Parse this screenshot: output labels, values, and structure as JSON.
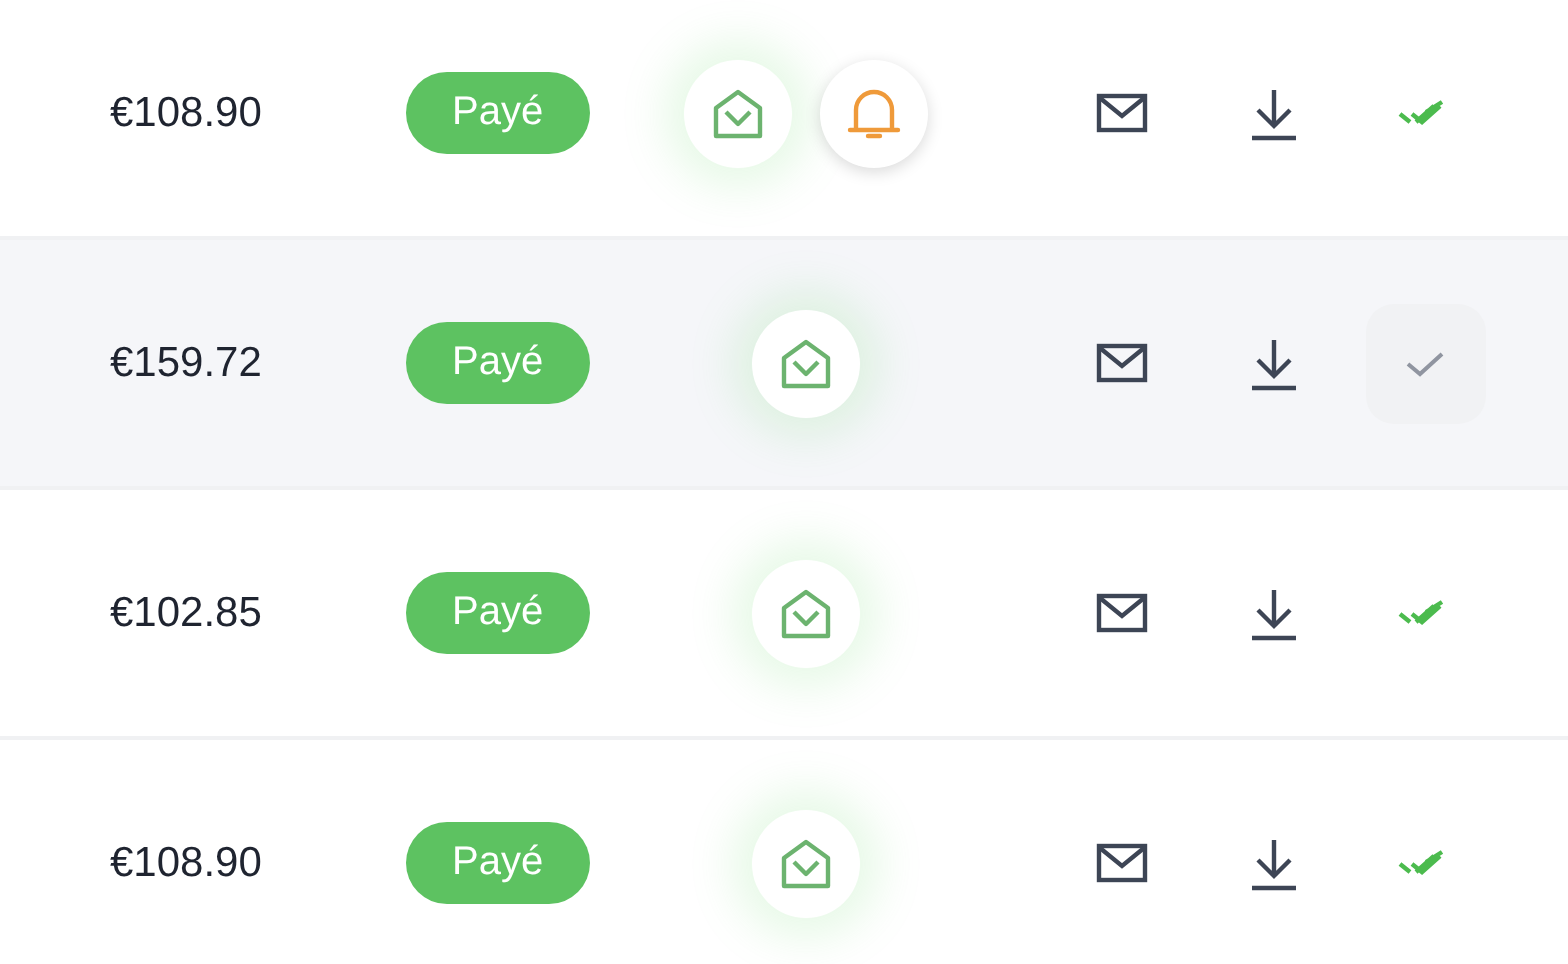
{
  "rows": [
    {
      "amount": "€108.90",
      "status": "Payé",
      "reminder": true,
      "confirmed": true
    },
    {
      "amount": "€159.72",
      "status": "Payé",
      "reminder": false,
      "confirmed": false
    },
    {
      "amount": "€102.85",
      "status": "Payé",
      "reminder": false,
      "confirmed": true
    },
    {
      "amount": "€108.90",
      "status": "Payé",
      "reminder": false,
      "confirmed": true
    }
  ]
}
